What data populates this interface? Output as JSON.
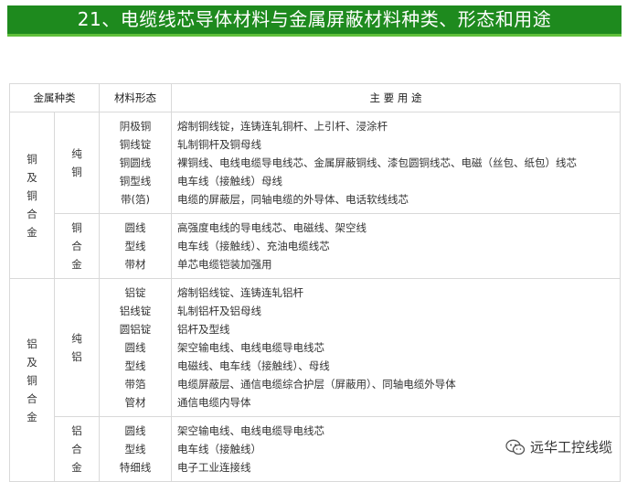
{
  "title": "21、电缆线芯导体材料与金属屏蔽材料种类、形态和用途",
  "table": {
    "headers": [
      "金属种类",
      "材料形态",
      "主 要 用 途"
    ],
    "groups": [
      {
        "category": "铜及铜合金",
        "subgroups": [
          {
            "name": "纯铜",
            "forms": [
              "阴极铜",
              "铜线锭",
              "铜圆线",
              "铜型线",
              "带(箔)"
            ],
            "uses": [
              "熔制铜线锭，连铸连轧铜杆、上引杆、浸涂杆",
              "轧制铜杆及铜母线",
              "裸铜线、电线电缆导电线芯、金属屏蔽铜线、漆包圆铜线芯、电磁（丝包、纸包）线芯",
              "电车线（接触线）母线",
              "电缆的屏蔽层，同轴电缆的外导体、电话软线线芯"
            ]
          },
          {
            "name": "铜合金",
            "forms": [
              "圆线",
              "型线",
              "带材"
            ],
            "uses": [
              "高强度电线的导电线芯、电磁线、架空线",
              "电车线（接触线）、充油电缆线芯",
              "单芯电缆铠装加强用"
            ]
          }
        ]
      },
      {
        "category": "铝及铜合金",
        "subgroups": [
          {
            "name": "纯铝",
            "forms": [
              "铝锭",
              "铝线锭",
              "圆铝锭",
              "圆线",
              "型线",
              "带箔",
              "管材"
            ],
            "uses": [
              "熔制铝线锭、连铸连轧铝杆",
              "轧制铝杆及铝母线",
              "铝杆及型线",
              "架空输电线、电线电缆导电线芯",
              "电磁线、电车线（接触线）、母线",
              "电缆屏蔽层、通信电缆综合护层（屏蔽用）、同轴电缆外导体",
              "通信电缆内导体"
            ]
          },
          {
            "name": "铝合金",
            "forms": [
              "圆线",
              "型线",
              "特细线"
            ],
            "uses": [
              "架空输电线、电线电缆导电线芯",
              "电车线（接触线）",
              "电子工业连接线"
            ]
          }
        ]
      }
    ]
  },
  "watermark": {
    "text": "远华工控线缆",
    "icon": "wechat-icon"
  }
}
